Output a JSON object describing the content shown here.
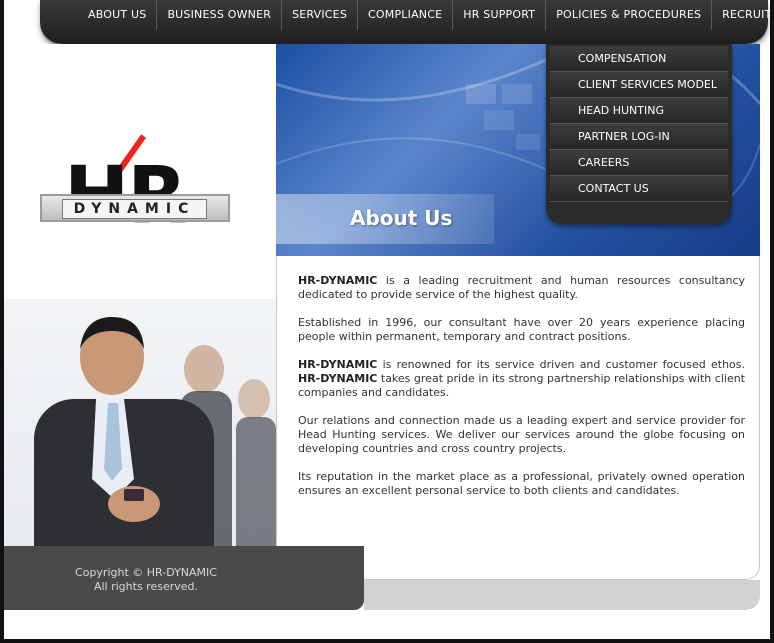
{
  "nav": [
    "ABOUT US",
    "BUSINESS OWNER",
    "SERVICES",
    "COMPLIANCE",
    "HR SUPPORT",
    "POLICIES & PROCEDURES",
    "RECRUITING"
  ],
  "submenu": [
    "COMPENSATION",
    "CLIENT SERVICES MODEL",
    "HEAD HUNTING",
    "PARTNER LOG-IN",
    "CAREERS",
    "CONTACT US"
  ],
  "logo": {
    "hr": "HR",
    "dynamic": "DYNAMIC"
  },
  "banner": {
    "title": "About Us"
  },
  "content": {
    "p1_brand": "HR-DYNAMIC",
    "p1_text": " is a leading recruitment and human resources consultancy dedicated to provide service of the highest quality.",
    "p2": "Established in 1996, our consultant have over 20 years experience placing people within permanent, temporary and contract positions.",
    "p3_brand1": "HR-DYNAMIC",
    "p3_text1": " is renowned for its service driven and customer focused ethos. ",
    "p3_brand2": "HR-DYNAMIC",
    "p3_text2": " takes great pride in its strong partnership relationships with client companies and candidates.",
    "p4": "Our relations and connection made us a leading expert and service provider for Head Hunting services. We deliver our services around the globe focusing on developing countries and cross country projects.",
    "p5": "Its reputation in the market place as a professional, privately owned operation ensures an excellent personal service to both clients and candidates."
  },
  "footer": {
    "copyright": "Copyright © HR-DYNAMIC",
    "rights": "All rights reserved."
  },
  "colors": {
    "accent": "#e8261f",
    "nav_bg": "#2b2b2b",
    "banner_blue": "#2350a0"
  }
}
